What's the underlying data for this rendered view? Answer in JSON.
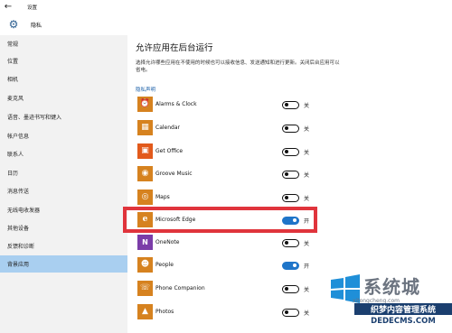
{
  "window": {
    "title": "设置",
    "back_icon": "arrow-left-icon"
  },
  "header": {
    "icon": "gear-icon",
    "title": "隐私"
  },
  "sidebar": {
    "items": [
      {
        "label": "常规",
        "selected": false
      },
      {
        "label": "位置",
        "selected": false
      },
      {
        "label": "相机",
        "selected": false
      },
      {
        "label": "麦克风",
        "selected": false
      },
      {
        "label": "语音、墨迹书写和键入",
        "selected": false
      },
      {
        "label": "帐户信息",
        "selected": false
      },
      {
        "label": "联系人",
        "selected": false
      },
      {
        "label": "日历",
        "selected": false
      },
      {
        "label": "消息传送",
        "selected": false
      },
      {
        "label": "无线电收发器",
        "selected": false
      },
      {
        "label": "其他设备",
        "selected": false
      },
      {
        "label": "反馈和诊断",
        "selected": false
      },
      {
        "label": "背景应用",
        "selected": true
      }
    ]
  },
  "main": {
    "title": "允许应用在后台运行",
    "description": "选择允许哪些应用在不使用的时候也可以接收信息、发送通知和进行更新。关闭后台应用可以省电。",
    "privacy_link": "隐私声明",
    "apps": [
      {
        "name": "Alarms & Clock",
        "icon": "alarm-clock-icon",
        "icon_color": "#d6821f",
        "state": "关",
        "on": false
      },
      {
        "name": "Calendar",
        "icon": "calendar-icon",
        "icon_color": "#d6821f",
        "state": "关",
        "on": false
      },
      {
        "name": "Get Office",
        "icon": "office-icon",
        "icon_color": "#e25a1c",
        "state": "关",
        "on": false
      },
      {
        "name": "Groove Music",
        "icon": "music-disc-icon",
        "icon_color": "#d6821f",
        "state": "关",
        "on": false
      },
      {
        "name": "Maps",
        "icon": "map-pin-icon",
        "icon_color": "#d6821f",
        "state": "关",
        "on": false
      },
      {
        "name": "Microsoft Edge",
        "icon": "edge-browser-icon",
        "icon_color": "#d6821f",
        "state": "开",
        "on": true
      },
      {
        "name": "OneNote",
        "icon": "onenote-icon",
        "icon_color": "#7b3da8",
        "state": "关",
        "on": false
      },
      {
        "name": "People",
        "icon": "people-icon",
        "icon_color": "#d6821f",
        "state": "开",
        "on": true
      },
      {
        "name": "Phone Companion",
        "icon": "phone-companion-icon",
        "icon_color": "#d6821f",
        "state": "关",
        "on": false
      },
      {
        "name": "Photos",
        "icon": "photos-icon",
        "icon_color": "#d6821f",
        "state": "关",
        "on": false
      }
    ]
  },
  "watermark": {
    "big_text": "系统城",
    "sub_text": "xitongcheng.com",
    "band_text": "织梦内容管理系统",
    "band_text2": "DEDECMS.COM"
  },
  "colors": {
    "accent": "#1f75c9",
    "selected_nav": "#a9cff0",
    "highlight": "#e0343c"
  }
}
